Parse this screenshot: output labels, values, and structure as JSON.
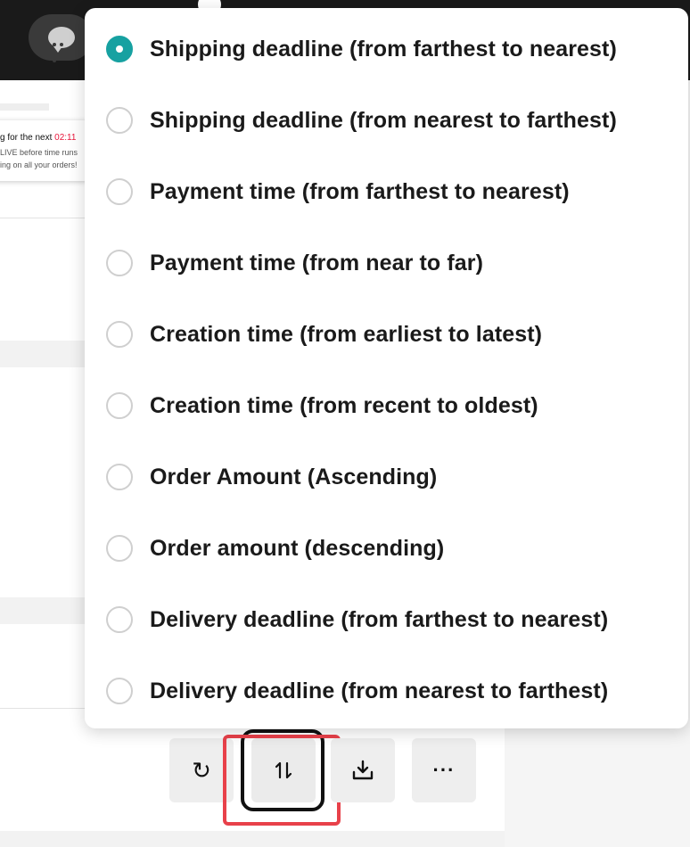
{
  "background": {
    "banner": {
      "line1_text": "g for the next ",
      "line1_timer": "02:11",
      "line2_text": "LIVE before time runs",
      "line3_text": "ing on all your orders!"
    }
  },
  "toolbar": {
    "refresh_icon": "↻",
    "sort_icon": "⥮",
    "download_icon": "download-icon",
    "more_icon": "···"
  },
  "sort_menu": {
    "selected_index": 0,
    "accent_color": "#17a1a1",
    "options": [
      {
        "label": "Shipping deadline (from farthest to nearest)"
      },
      {
        "label": "Shipping deadline (from nearest to farthest)"
      },
      {
        "label": "Payment time (from farthest to nearest)"
      },
      {
        "label": "Payment time (from near to far)"
      },
      {
        "label": "Creation time (from earliest to latest)"
      },
      {
        "label": "Creation time (from recent to oldest)"
      },
      {
        "label": "Order Amount (Ascending)"
      },
      {
        "label": "Order amount (descending)"
      },
      {
        "label": "Delivery deadline (from farthest to nearest)"
      },
      {
        "label": "Delivery deadline (from nearest to farthest)"
      }
    ]
  },
  "highlight_color": "#e8414a"
}
